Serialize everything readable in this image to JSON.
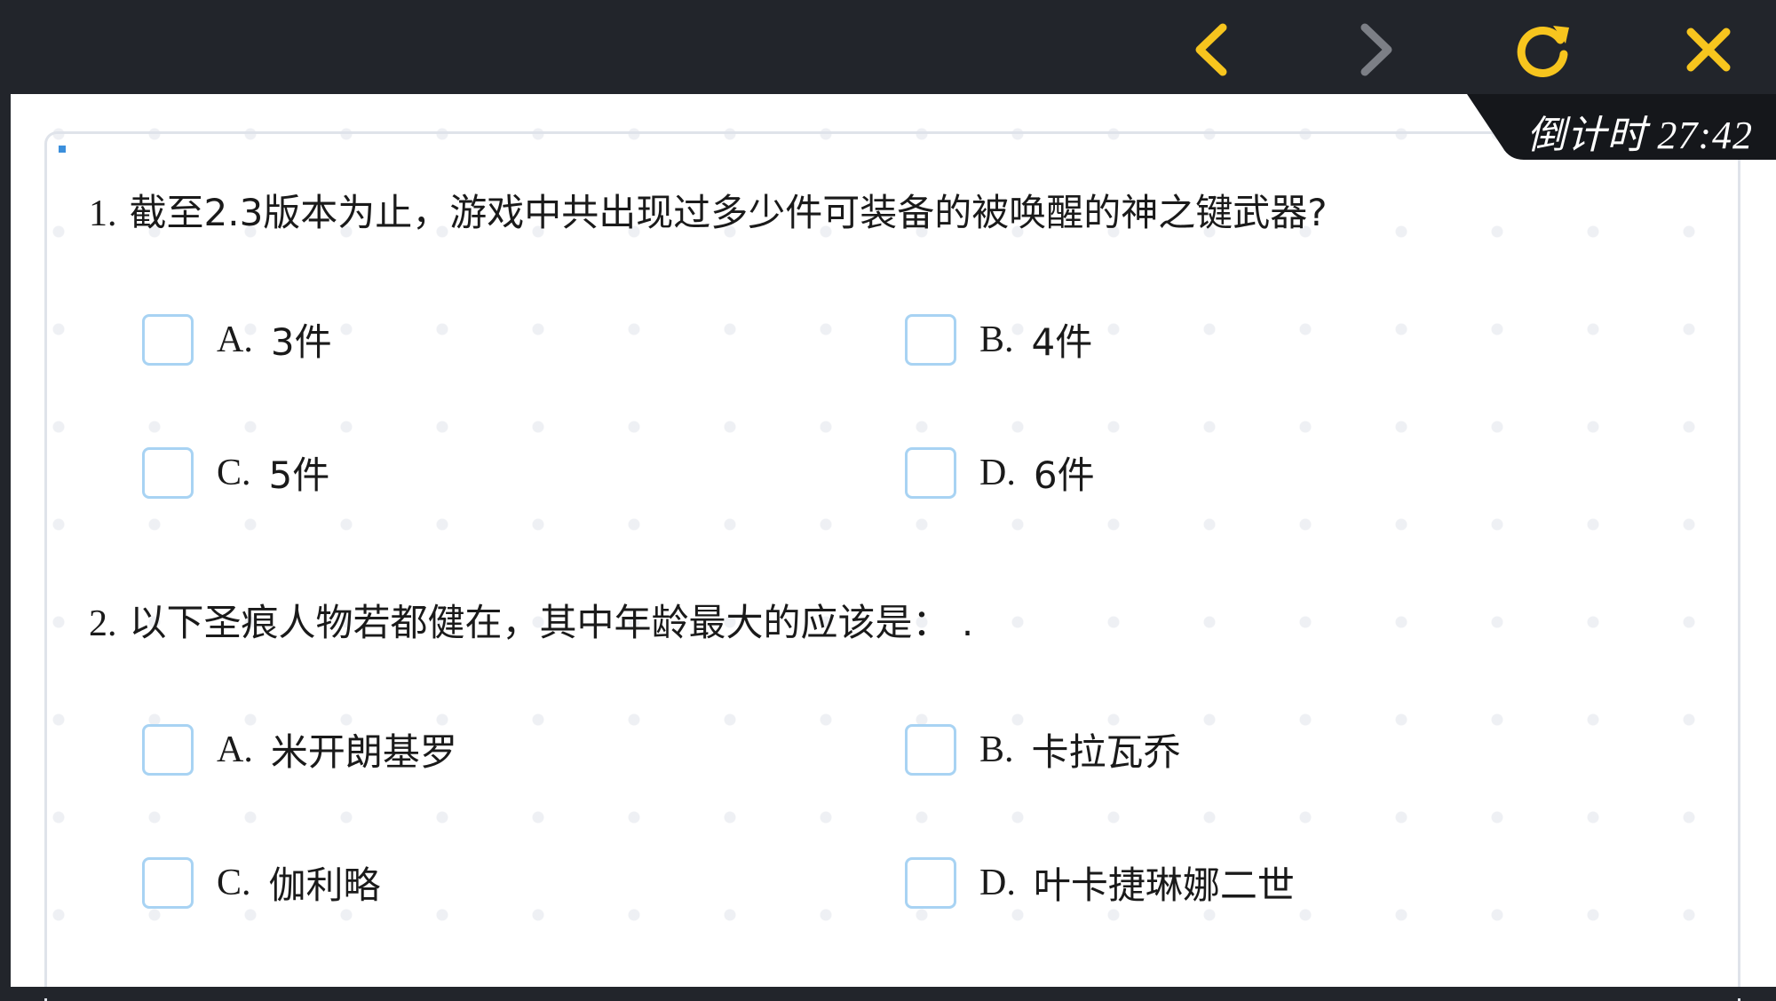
{
  "toolbar": {
    "back_icon": "chevron-left-icon",
    "forward_icon": "chevron-right-icon",
    "refresh_icon": "refresh-icon",
    "close_icon": "close-icon",
    "accent_color": "#f7c51e",
    "disabled_color": "#7c7f86"
  },
  "timer": {
    "text": "倒计时 27:42"
  },
  "questions": [
    {
      "number": "1.",
      "text": "截至2.3版本为止，游戏中共出现过多少件可装备的被唤醒的神之键武器?",
      "options": [
        {
          "letter": "A.",
          "text": "3件"
        },
        {
          "letter": "B.",
          "text": "4件"
        },
        {
          "letter": "C.",
          "text": "5件"
        },
        {
          "letter": "D.",
          "text": "6件"
        }
      ]
    },
    {
      "number": "2.",
      "text": "以下圣痕人物若都健在，其中年龄最大的应该是： .",
      "options": [
        {
          "letter": "A.",
          "text": "米开朗基罗"
        },
        {
          "letter": "B.",
          "text": "卡拉瓦乔"
        },
        {
          "letter": "C.",
          "text": "伽利略"
        },
        {
          "letter": "D.",
          "text": "叶卡捷琳娜二世"
        }
      ]
    }
  ]
}
